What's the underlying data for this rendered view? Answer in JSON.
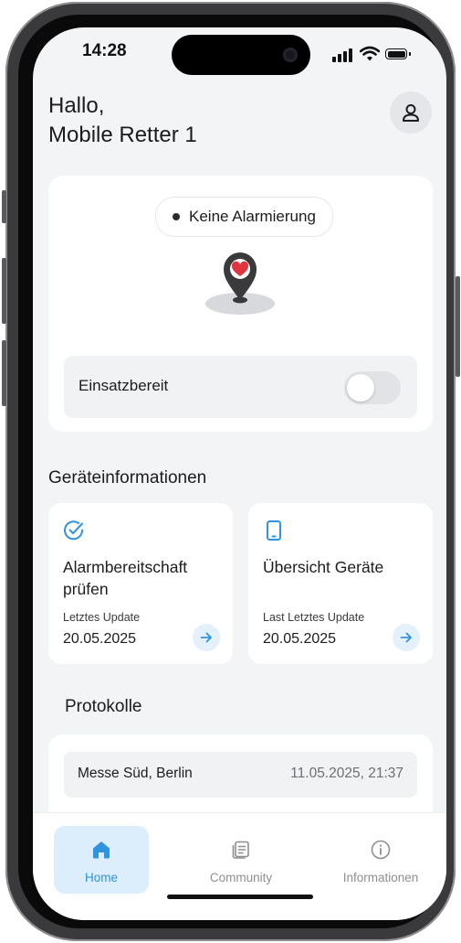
{
  "status_bar": {
    "time": "14:28"
  },
  "header": {
    "greeting": "Hallo,",
    "name": "Mobile Retter 1",
    "profile_icon": "user-icon"
  },
  "alarm_card": {
    "status_text": "Keine Alarmierung",
    "illustration": "map-pin-heart-icon",
    "ready_label": "Einsatzbereit",
    "ready_toggle_on": false
  },
  "devices": {
    "section_title": "Geräteinformationen",
    "cards": [
      {
        "icon": "check-circle-icon",
        "title": "Alarmbereitschaft prüfen",
        "subtitle": "Letztes Update",
        "date": "20.05.2025"
      },
      {
        "icon": "smartphone-icon",
        "title": "Übersicht Geräte",
        "subtitle": "Last Letztes Update",
        "date": "20.05.2025"
      }
    ]
  },
  "protocols": {
    "section_title": "Protokolle",
    "items": [
      {
        "place": "Messe Süd, Berlin",
        "datetime": "11.05.2025, 21:37"
      }
    ]
  },
  "tabbar": {
    "tabs": [
      {
        "label": "Home",
        "icon": "home-icon",
        "active": true
      },
      {
        "label": "Community",
        "icon": "community-icon",
        "active": false
      },
      {
        "label": "Informationen",
        "icon": "info-icon",
        "active": false
      }
    ]
  },
  "colors": {
    "accent": "#2f94e0",
    "accent_light": "#dceefb",
    "background": "#f3f4f6",
    "pin_heart": "#e0353f"
  }
}
